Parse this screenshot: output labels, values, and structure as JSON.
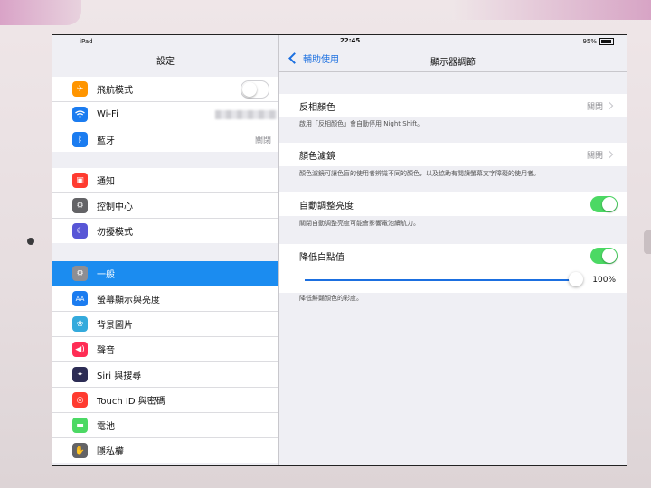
{
  "status": {
    "device": "iPad",
    "time": "22:45",
    "battery": "95%"
  },
  "sidebar": {
    "title": "設定",
    "groups": [
      [
        {
          "label": "飛航模式",
          "icon": "airplane-icon",
          "color": "#ff9500",
          "type": "toggle",
          "value": ""
        },
        {
          "label": "Wi-Fi",
          "icon": "wifi-icon",
          "color": "#1b7cf0",
          "type": "value",
          "value": ""
        },
        {
          "label": "藍牙",
          "icon": "bluetooth-icon",
          "color": "#1b7cf0",
          "type": "value",
          "value": "關閉"
        }
      ],
      [
        {
          "label": "通知",
          "icon": "notifications-icon",
          "color": "#ff3b30",
          "value": ""
        },
        {
          "label": "控制中心",
          "icon": "control-center-icon",
          "color": "#636366",
          "value": ""
        },
        {
          "label": "勿擾模式",
          "icon": "moon-icon",
          "color": "#5856d6",
          "value": ""
        }
      ],
      [
        {
          "label": "一般",
          "icon": "gear-icon",
          "color": "#8e8e93",
          "selected": true,
          "value": ""
        },
        {
          "label": "螢幕顯示與亮度",
          "icon": "display-icon",
          "color": "#1b7cf0",
          "value": ""
        },
        {
          "label": "背景圖片",
          "icon": "wallpaper-icon",
          "color": "#34aadc",
          "value": ""
        },
        {
          "label": "聲音",
          "icon": "sound-icon",
          "color": "#ff2d55",
          "value": ""
        },
        {
          "label": "Siri 與搜尋",
          "icon": "siri-icon",
          "color": "#2c2c54",
          "value": ""
        },
        {
          "label": "Touch ID 與密碼",
          "icon": "fingerprint-icon",
          "color": "#ff3b30",
          "value": ""
        },
        {
          "label": "電池",
          "icon": "battery-icon",
          "color": "#4cd964",
          "value": ""
        },
        {
          "label": "隱私權",
          "icon": "hand-icon",
          "color": "#636366",
          "value": ""
        }
      ]
    ]
  },
  "detail": {
    "back_label": "輔助使用",
    "title": "顯示器調節",
    "invert_colors": {
      "label": "反相顏色",
      "value": "關閉",
      "footer": "啟用「反相顏色」會自動停用 Night Shift。"
    },
    "color_filters": {
      "label": "顏色濾鏡",
      "value": "關閉",
      "footer": "顏色濾鏡可讓色盲的使用者辨識不同的顏色，以及協助有閱讀螢幕文字障礙的使用者。"
    },
    "auto_brightness": {
      "label": "自動調整亮度",
      "on": true,
      "footer": "關閉自動調整亮度可能會影響電池續航力。"
    },
    "reduce_white_point": {
      "label": "降低白點值",
      "on": true,
      "slider_value": "100%",
      "slider_fraction": 1.0,
      "footer": "降低鮮豔顏色的彩度。"
    }
  }
}
